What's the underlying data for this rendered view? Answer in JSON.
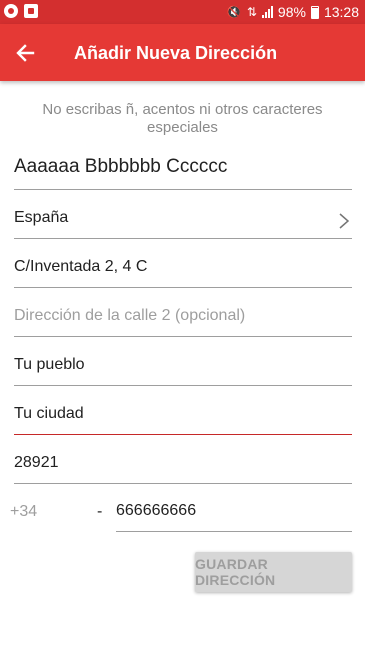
{
  "status_bar": {
    "battery": "98%",
    "time": "13:28"
  },
  "app_bar": {
    "title": "Añadir Nueva Dirección",
    "back_icon": "arrow-back-icon",
    "background": "#e53935"
  },
  "form": {
    "hint": "No escribas ñ, acentos ni otros caracteres especiales",
    "name": "Aaaaaa Bbbbbbb Cccccc",
    "country": "España",
    "street1": "C/Inventada 2, 4 C",
    "street2_placeholder": "Dirección de la calle 2 (opcional)",
    "town": "Tu pueblo",
    "city": "Tu ciudad",
    "postcode": "28921",
    "phone_prefix": "+34",
    "phone_separator": "-",
    "phone": "666666666",
    "active_field_color": "#c62828"
  },
  "actions": {
    "save_label": "GUARDAR DIRECCIÓN"
  }
}
